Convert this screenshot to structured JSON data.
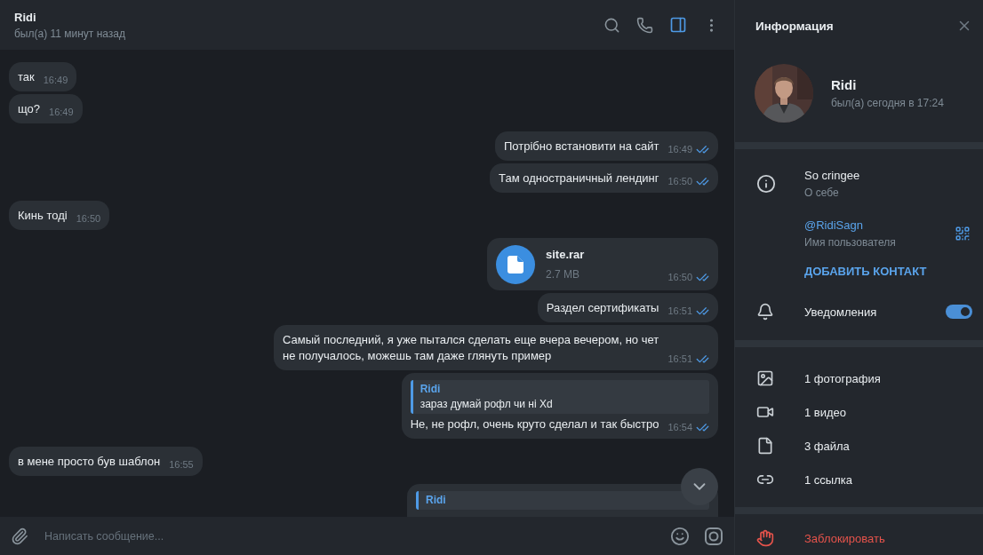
{
  "chat": {
    "title": "Ridi",
    "status": "был(а) 11 минут назад",
    "info_panel_open": true
  },
  "messages": [
    {
      "kind": "text",
      "outgoing": false,
      "text": "так",
      "time": "16:49"
    },
    {
      "kind": "text",
      "outgoing": false,
      "text": "що?",
      "time": "16:49"
    },
    {
      "kind": "text",
      "outgoing": true,
      "text": "Потрібно встановити на сайт",
      "time": "16:49",
      "read": true
    },
    {
      "kind": "text",
      "outgoing": true,
      "text": "Там одностраничный лендинг",
      "time": "16:50",
      "read": true
    },
    {
      "kind": "text",
      "outgoing": false,
      "text": "Кинь тоді",
      "time": "16:50"
    },
    {
      "kind": "file",
      "outgoing": true,
      "file_name": "site.rar",
      "size": "2.7 MB",
      "time": "16:50",
      "read": true
    },
    {
      "kind": "text",
      "outgoing": true,
      "text": "Раздел сертификаты",
      "time": "16:51",
      "read": true
    },
    {
      "kind": "text",
      "outgoing": true,
      "text": "Самый последний, я уже пытался сделать еще вчера вечером, но чет не получалось, можешь там даже глянуть пример",
      "time": "16:51",
      "read": true
    },
    {
      "kind": "reply",
      "outgoing": true,
      "reply_name": "Ridi",
      "reply_text": "зараз думай рофл чи ні Xd",
      "text": "Не, не рофл, очень круто сделал и так быстро",
      "time": "16:54",
      "read": true
    },
    {
      "kind": "text",
      "outgoing": false,
      "text": "в мене просто був шаблон",
      "time": "16:55"
    },
    {
      "kind": "reply_cut",
      "outgoing": true,
      "reply_name": "Ridi"
    }
  ],
  "composer": {
    "placeholder": "Написать сообщение..."
  },
  "info": {
    "title": "Информация",
    "name": "Ridi",
    "status": "был(а) сегодня в 17:24",
    "bio": "So cringee",
    "bio_label": "О себе",
    "username": "@RidiSagn",
    "username_label": "Имя пользователя",
    "add_contact": "ДОБАВИТЬ КОНТАКТ",
    "notifications": {
      "label": "Уведомления",
      "on": true
    },
    "media": [
      {
        "label": "1 фотография"
      },
      {
        "kind": "video",
        "label": "1 видео"
      },
      {
        "kind": "file",
        "label": "3 файла"
      },
      {
        "kind": "link",
        "label": "1 ссылка"
      }
    ],
    "block": "Заблокировать"
  }
}
